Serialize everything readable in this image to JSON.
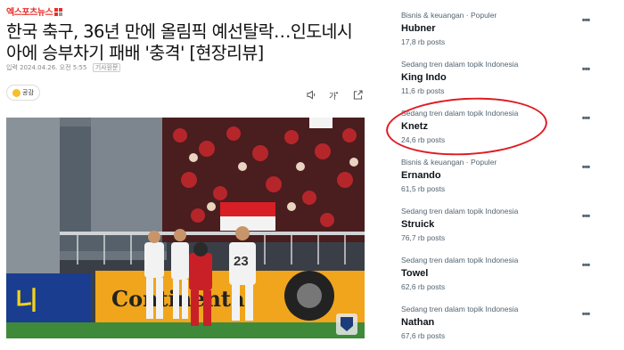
{
  "article": {
    "logo_text": "엑스포츠뉴스",
    "headline": "한국 축구, 36년 만에 올림픽 예선탈락…인도네시아에 승부차기 패배 '충격' [현장리뷰]",
    "meta_date": "입력 2024.04.26. 오전 5:55",
    "meta_source": "기사원문",
    "like_label": "공감",
    "photo": {
      "ad_board_left": "니",
      "ad_board_brand": "Continental",
      "player_number": "23"
    }
  },
  "trends": [
    {
      "context": "Bisnis & keuangan · Populer",
      "name": "Hubner",
      "count": "17,8 rb posts"
    },
    {
      "context": "Sedang tren dalam topik Indonesia",
      "name": "King Indo",
      "count": "11,6 rb posts"
    },
    {
      "context": "Sedang tren dalam topik Indonesia",
      "name": "Knetz",
      "count": "24,6 rb posts"
    },
    {
      "context": "Bisnis & keuangan · Populer",
      "name": "Ernando",
      "count": "61,5 rb posts"
    },
    {
      "context": "Sedang tren dalam topik Indonesia",
      "name": "Struick",
      "count": "76,7 rb posts"
    },
    {
      "context": "Sedang tren dalam topik Indonesia",
      "name": "Towel",
      "count": "62,6 rb posts"
    },
    {
      "context": "Sedang tren dalam topik Indonesia",
      "name": "Nathan",
      "count": "67,6 rb posts"
    }
  ],
  "colors": {
    "highlight_circle": "#e01b22",
    "logo": "#e8302b",
    "muted": "#536471"
  }
}
